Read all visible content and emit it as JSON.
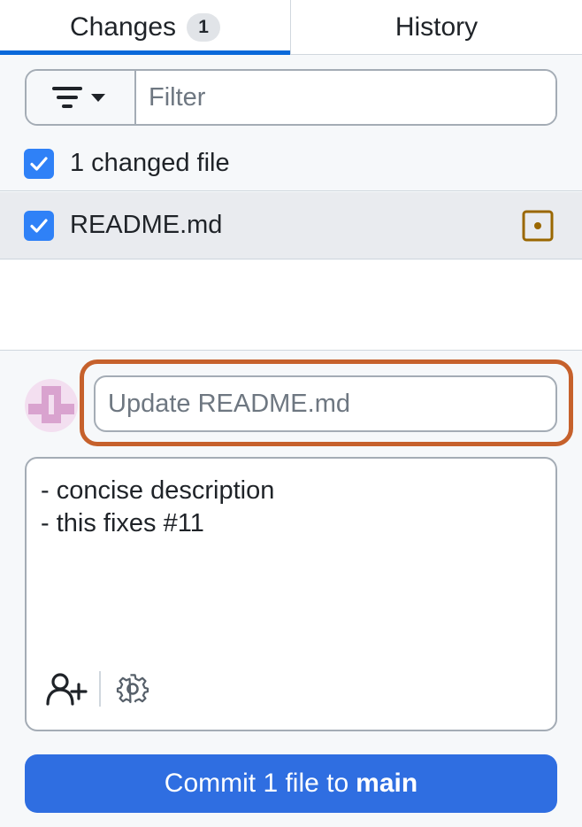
{
  "tabs": [
    {
      "label": "Changes",
      "count": "1",
      "active": true
    },
    {
      "label": "History",
      "active": false
    }
  ],
  "filter": {
    "placeholder": "Filter",
    "value": "",
    "button_icon": "filter-icon"
  },
  "files": {
    "header_label": "1 changed file",
    "header_checked": true,
    "items": [
      {
        "name": "README.md",
        "checked": true,
        "status_icon": "file-modified-icon"
      }
    ]
  },
  "commit": {
    "summary_placeholder": "Update README.md",
    "summary_value": "",
    "description": "- concise description\n- this fixes #11",
    "add_coauthor_icon": "person-add-icon",
    "settings_icon": "gear-icon",
    "button_prefix": "Commit 1 file to",
    "branch": "main"
  },
  "colors": {
    "accent": "#0969da",
    "checkbox": "#2f81f7",
    "commit_button": "#2f6ee1",
    "highlight": "#c6612c",
    "modified": "#9a6700",
    "avatar": "#d9a3cf"
  }
}
